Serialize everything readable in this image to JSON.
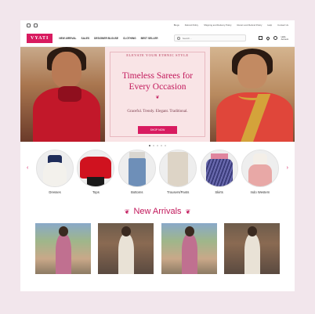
{
  "topbar": {
    "social_icons": [
      "instagram-icon",
      "facebook-icon"
    ],
    "links": [
      "Blogs",
      "Refund Policy",
      "Shipping and Delivery Policy",
      "Return and Refund Policy",
      "Help",
      "Contact Us"
    ]
  },
  "header": {
    "logo": "VYATI",
    "nav": [
      "NEW ARRIVAL",
      "SALES",
      "DESIGNER BLOUSE",
      "CLOTHING",
      "BEST SELLER"
    ],
    "search_placeholder": "Search...",
    "account_line1": "Hello",
    "account_line2": "Account"
  },
  "hero": {
    "eyebrow": "ELEVATE YOUR ETHNIC STYLE",
    "title": "Timeless Sarees for Every Occasion",
    "ornament": "❦",
    "subtitle": "Graceful. Trendy. Elegant. Traditional.",
    "button": "SHOP NOW",
    "slides": 5,
    "active_slide": 1
  },
  "categories": {
    "items": [
      "Dresses",
      "Tops",
      "Bottoms",
      "Trousers/Pants",
      "Skirts",
      "Indo Western"
    ]
  },
  "new_arrivals": {
    "title": "New Arrivals",
    "ornament": "❦"
  },
  "colors": {
    "accent": "#d81b60",
    "hero_bg": "#f9e4e6",
    "page_bg": "#f2e6ec"
  }
}
